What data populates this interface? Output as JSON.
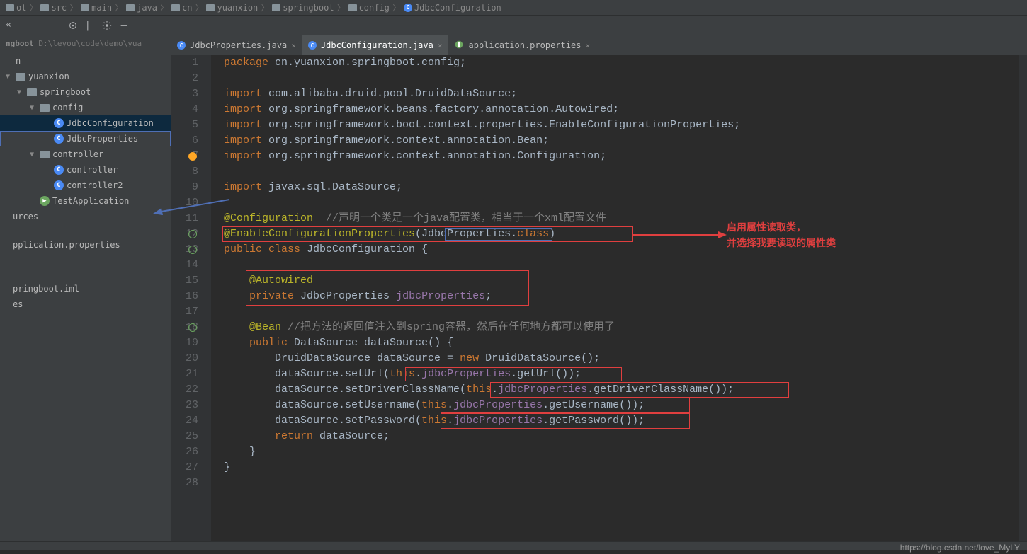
{
  "breadcrumb": {
    "items": [
      {
        "icon": "folder",
        "label": "ot"
      },
      {
        "icon": "folder",
        "label": "src"
      },
      {
        "icon": "folder",
        "label": "main"
      },
      {
        "icon": "folder",
        "label": "java"
      },
      {
        "icon": "folder",
        "label": "cn"
      },
      {
        "icon": "folder",
        "label": "yuanxion"
      },
      {
        "icon": "folder",
        "label": "springboot"
      },
      {
        "icon": "folder",
        "label": "config"
      },
      {
        "icon": "class",
        "label": "JdbcConfiguration"
      }
    ]
  },
  "toolbar": {
    "left_chev": "«"
  },
  "sidebar": {
    "header_prefix": "ngboot",
    "header_path": "D:\\leyou\\code\\demo\\yua",
    "tree": [
      {
        "depth": 1,
        "type": "plain",
        "label": "n",
        "arrow": ""
      },
      {
        "depth": 1,
        "type": "folder",
        "label": "yuanxion",
        "arrow": "▼"
      },
      {
        "depth": 2,
        "type": "folder",
        "label": "springboot",
        "arrow": "▼"
      },
      {
        "depth": 3,
        "type": "folder",
        "label": "config",
        "arrow": "▼"
      },
      {
        "depth": 4,
        "type": "class",
        "label": "JdbcConfiguration",
        "arrow": "",
        "sel": true
      },
      {
        "depth": 4,
        "type": "class",
        "label": "JdbcProperties",
        "arrow": "",
        "blue": true
      },
      {
        "depth": 3,
        "type": "folder",
        "label": "controller",
        "arrow": "▼"
      },
      {
        "depth": 4,
        "type": "class",
        "label": "controller",
        "arrow": ""
      },
      {
        "depth": 4,
        "type": "class",
        "label": "controller2",
        "arrow": ""
      },
      {
        "depth": 3,
        "type": "app",
        "label": "TestApplication",
        "arrow": ""
      },
      {
        "depth": 0,
        "type": "plain",
        "label": "urces",
        "arrow": ""
      },
      {
        "depth": 0,
        "type": "plain",
        "label": "pplication.properties",
        "arrow": ""
      },
      {
        "depth": 0,
        "type": "plain",
        "label": "pringboot.iml",
        "arrow": ""
      },
      {
        "depth": 0,
        "type": "plain",
        "label": "es",
        "arrow": ""
      }
    ]
  },
  "tabs": {
    "items": [
      {
        "icon": "class",
        "label": "JdbcProperties.java",
        "active": false
      },
      {
        "icon": "class",
        "label": "JdbcConfiguration.java",
        "active": true
      },
      {
        "icon": "prop",
        "label": "application.properties",
        "active": false
      }
    ]
  },
  "code": {
    "lines": [
      {
        "n": 1,
        "html": "<span class='kw'>package</span> cn.yuanxion.springboot.config;"
      },
      {
        "n": 2,
        "html": ""
      },
      {
        "n": 3,
        "html": "<span class='kw'>import</span> com.alibaba.druid.pool.DruidDataSource;"
      },
      {
        "n": 4,
        "html": "<span class='kw'>import</span> org.springframework.beans.factory.annotation.<span class='ident'>Autowired</span>;"
      },
      {
        "n": 5,
        "html": "<span class='kw'>import</span> org.springframework.boot.context.properties.<span class='ident'>EnableConfigurationProperties</span>;"
      },
      {
        "n": 6,
        "html": "<span class='kw'>import</span> org.springframework.context.annotation.<span class='ident'>Bean</span>;"
      },
      {
        "n": 7,
        "html": "<span class='kw'>import</span> org.springframework.context.annotation.<span class='ident'>Configuration</span>;",
        "bulb": true
      },
      {
        "n": 8,
        "html": ""
      },
      {
        "n": 9,
        "html": "<span class='kw'>import</span> javax.sql.DataSource;"
      },
      {
        "n": 10,
        "html": ""
      },
      {
        "n": 11,
        "html": "<span class='anno'>@Configuration</span>  <span class='cmt'>//声明一个类是一个java配置类，相当于一个xml配置文件</span>"
      },
      {
        "n": 12,
        "html": "<span class='anno'>@EnableConfigurationProperties</span>(JdbcProperties.<span class='kw'>class</span>)",
        "refresh": true
      },
      {
        "n": 13,
        "html": "<span class='kw'>public class</span> JdbcConfiguration {",
        "refresh": true
      },
      {
        "n": 14,
        "html": ""
      },
      {
        "n": 15,
        "html": "    <span class='anno'>@Autowired</span>"
      },
      {
        "n": 16,
        "html": "    <span class='kw'>private</span> JdbcProperties <span class='field'>jdbcProperties</span>;"
      },
      {
        "n": 17,
        "html": ""
      },
      {
        "n": 18,
        "html": "    <span class='anno'>@Bean</span> <span class='cmt'>//把方法的返回值注入到spring容器，然后在任何地方都可以使用了</span>",
        "refresh": true
      },
      {
        "n": 19,
        "html": "    <span class='kw'>public</span> DataSource dataSource() {"
      },
      {
        "n": 20,
        "html": "        DruidDataSource dataSource = <span class='kw'>new</span> DruidDataSource();"
      },
      {
        "n": 21,
        "html": "        dataSource.setUrl(<span class='kw'>this</span>.<span class='field'>jdbcProperties</span>.getUrl());"
      },
      {
        "n": 22,
        "html": "        dataSource.setDriverClassName(<span class='kw'>this</span>.<span class='field'>jdbcProperties</span>.getDriverClassName());"
      },
      {
        "n": 23,
        "html": "        dataSource.setUsername(<span class='kw'>this</span>.<span class='field'>jdbcProperties</span>.getUsername());"
      },
      {
        "n": 24,
        "html": "        dataSource.setPassword(<span class='kw'>this</span>.<span class='field'>jdbcProperties</span>.getPassword());"
      },
      {
        "n": 25,
        "html": "        <span class='kw'>return</span> dataSource;"
      },
      {
        "n": 26,
        "html": "    }"
      },
      {
        "n": 27,
        "html": "}"
      },
      {
        "n": 28,
        "html": ""
      }
    ]
  },
  "annotations": {
    "callout1_line1": "启用属性读取类，",
    "callout1_line2": "并选择我要读取的属性类"
  },
  "watermark": "https://blog.csdn.net/love_MyLY"
}
